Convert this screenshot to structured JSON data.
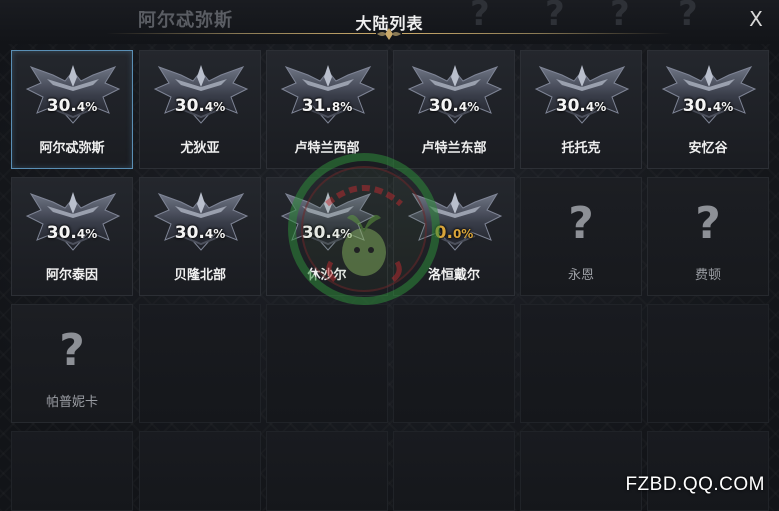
{
  "header": {
    "title": "大陆列表",
    "background_title": "阿尔忒弥斯",
    "close_label": "X"
  },
  "continents": [
    {
      "name": "阿尔忒弥斯",
      "pct_main": "30.",
      "pct_small": "4%",
      "locked": false,
      "selected": true
    },
    {
      "name": "尤狄亚",
      "pct_main": "30.",
      "pct_small": "4%",
      "locked": false,
      "selected": false
    },
    {
      "name": "卢特兰西部",
      "pct_main": "31.",
      "pct_small": "8%",
      "locked": false,
      "selected": false
    },
    {
      "name": "卢特兰东部",
      "pct_main": "30.",
      "pct_small": "4%",
      "locked": false,
      "selected": false
    },
    {
      "name": "托托克",
      "pct_main": "30.",
      "pct_small": "4%",
      "locked": false,
      "selected": false
    },
    {
      "name": "安忆谷",
      "pct_main": "30.",
      "pct_small": "4%",
      "locked": false,
      "selected": false
    },
    {
      "name": "阿尔泰因",
      "pct_main": "30.",
      "pct_small": "4%",
      "locked": false,
      "selected": false
    },
    {
      "name": "贝隆北部",
      "pct_main": "30.",
      "pct_small": "4%",
      "locked": false,
      "selected": false
    },
    {
      "name": "休沙尔",
      "pct_main": "30.",
      "pct_small": "4%",
      "locked": false,
      "selected": false
    },
    {
      "name": "洛恒戴尔",
      "pct_main": "0.",
      "pct_small": "0%",
      "locked": false,
      "selected": false
    },
    {
      "name": "永恩",
      "locked": true,
      "question_mark": "?"
    },
    {
      "name": "费顿",
      "locked": true,
      "question_mark": "?"
    },
    {
      "name": "帕普妮卡",
      "locked": true,
      "question_mark": "?"
    }
  ],
  "footer": {
    "site": "FZBD.QQ.COM"
  },
  "colors": {
    "selected_border": "#5a8fb5",
    "zero_pct": "#d9a43a",
    "gold_line": "#c9a96a"
  }
}
